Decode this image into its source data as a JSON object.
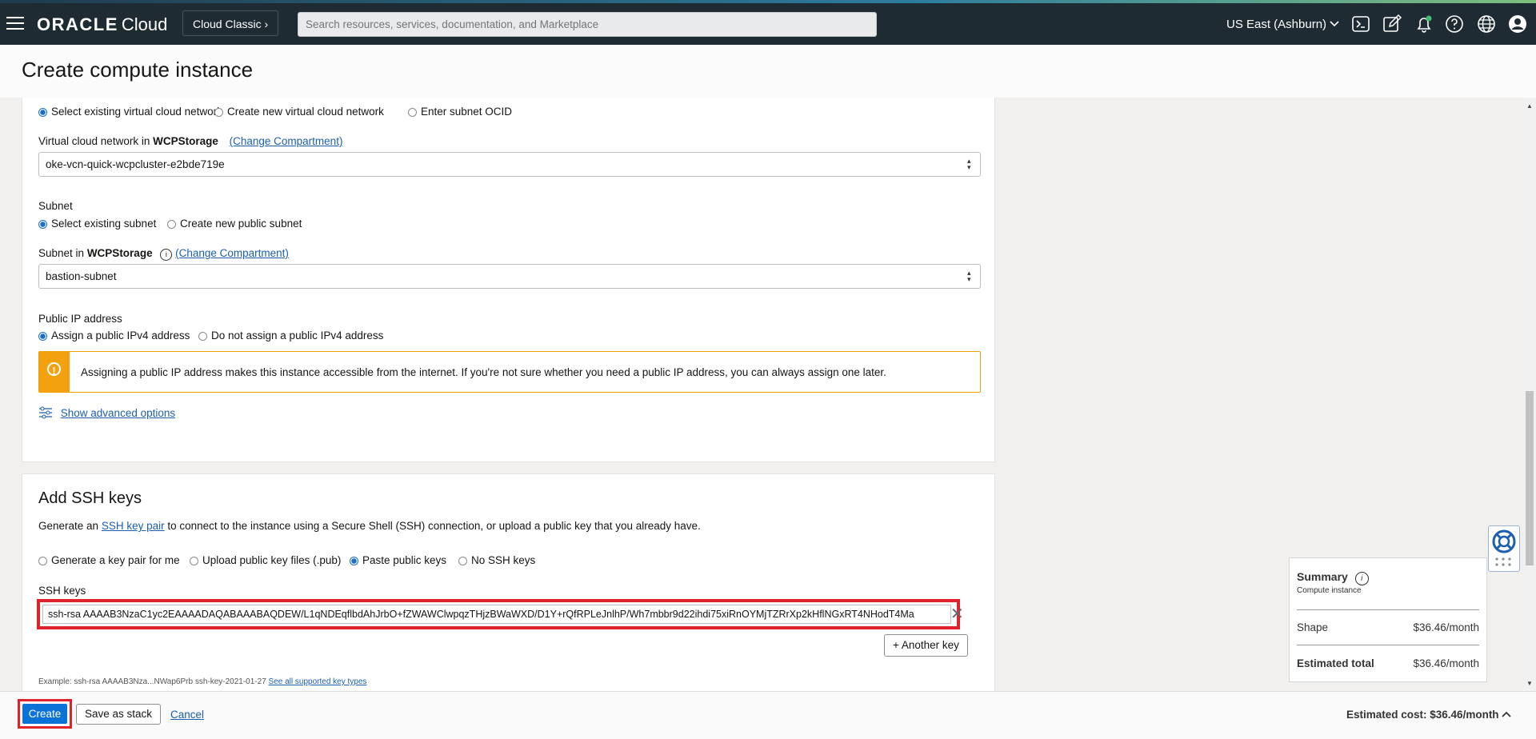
{
  "topbar": {
    "brand": "ORACLE",
    "brand_sub": "Cloud",
    "cloud_classic": "Cloud Classic",
    "search_placeholder": "Search resources, services, documentation, and Marketplace",
    "region": "US East (Ashburn)",
    "icons": [
      "menu-icon",
      "cloud-shell-icon",
      "edit-icon",
      "bell-icon",
      "help-icon",
      "globe-icon",
      "user-icon"
    ]
  },
  "page": {
    "title": "Create compute instance"
  },
  "network": {
    "vcn_options": [
      "Select existing virtual cloud network",
      "Create new virtual cloud network",
      "Enter subnet OCID"
    ],
    "vcn_label_prefix": "Virtual cloud network in",
    "compartment": "WCPStorage",
    "change_compartment": "(Change Compartment)",
    "vcn_value": "oke-vcn-quick-wcpcluster-e2bde719e",
    "subnet_heading": "Subnet",
    "subnet_options": [
      "Select existing subnet",
      "Create new public subnet"
    ],
    "subnet_label_prefix": "Subnet in",
    "subnet_value": "bastion-subnet",
    "public_ip_heading": "Public IP address",
    "public_ip_options": [
      "Assign a public IPv4 address",
      "Do not assign a public IPv4 address"
    ],
    "warning": "Assigning a public IP address makes this instance accessible from the internet. If you're not sure whether you need a public IP address, you can always assign one later.",
    "advanced": "Show advanced options"
  },
  "ssh": {
    "title": "Add SSH keys",
    "desc_pre": "Generate an",
    "desc_link": "SSH key pair",
    "desc_post": "to connect to the instance using a Secure Shell (SSH) connection, or upload a public key that you already have.",
    "options": [
      "Generate a key pair for me",
      "Upload public key files (.pub)",
      "Paste public keys",
      "No SSH keys"
    ],
    "keys_label": "SSH keys",
    "key_value": "ssh-rsa AAAAB3NzaC1yc2EAAAADAQABAAABAQDEW/L1qNDEqflbdAhJrbO+fZWAWClwpqzTHjzBWaWXD/D1Y+rQfRPLeJnlhP/Wh7mbbr9d22ihdi75xiRnOYMjTZRrXp2kHflNGxRT4NHodT4Ma",
    "another_key": "+ Another key",
    "example": "Example: ssh-rsa AAAAB3Nza...NWap6Prb ssh-key-2021-01-27",
    "example_link": "See all supported key types"
  },
  "summary": {
    "title": "Summary",
    "subtitle": "Compute instance",
    "shape_label": "Shape",
    "shape_value": "$36.46/month",
    "total_label": "Estimated total",
    "total_value": "$36.46/month"
  },
  "footer": {
    "create": "Create",
    "save_stack": "Save as stack",
    "cancel": "Cancel",
    "estimated_cost": "Estimated cost: $36.46/month"
  }
}
